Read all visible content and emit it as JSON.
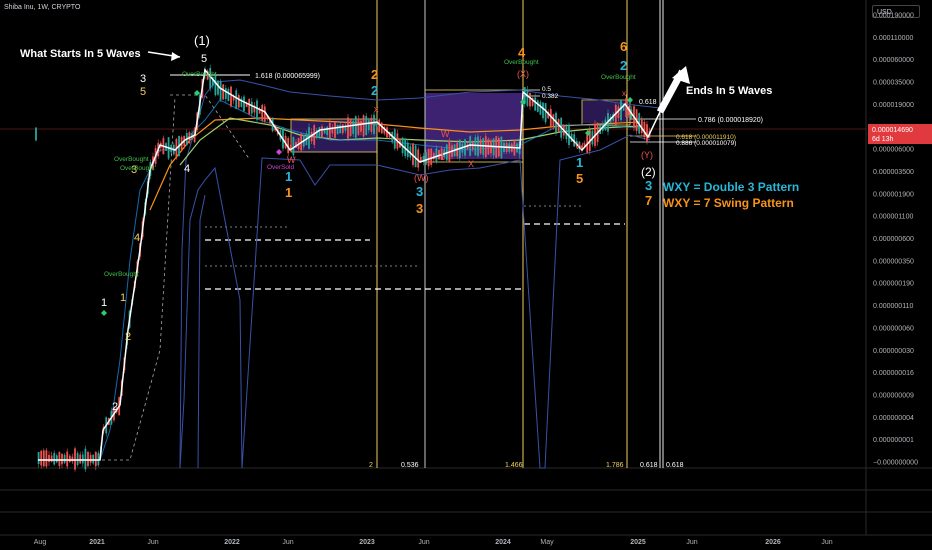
{
  "header": {
    "symbol_line": "Shiba Inu, 1W, CRYPTO",
    "currency_button": "USD"
  },
  "price_marker": {
    "value": "0.000014690",
    "countdown": "6d 13h"
  },
  "chart_data": {
    "type": "candlestick",
    "title": "Shiba Inu, 1W, CRYPTO",
    "y_scale": "log",
    "y_ticks": [
      "0.000190000",
      "0.000110000",
      "0.000060000",
      "0.000035000",
      "0.000019000",
      "0.000010000",
      "0.000006000",
      "0.000003500",
      "0.000001900",
      "0.000001100",
      "0.000000600",
      "0.000000350",
      "0.000000190",
      "0.000000110",
      "0.000000060",
      "0.000000030",
      "0.000000016",
      "0.000000009",
      "0.000000004",
      "0.000000001",
      "−0.000000000"
    ],
    "x_ticks": [
      "Aug",
      "2021",
      "Jun",
      "2022",
      "Jun",
      "2023",
      "Jun",
      "2024",
      "May",
      "2025",
      "Jun",
      "2026",
      "Jun"
    ],
    "last_price": 1.469e-05,
    "fib_levels": [
      {
        "label": "1.618 (0.000065999)",
        "value": 6.5999e-05
      },
      {
        "label": "0.5",
        "value": null
      },
      {
        "label": "0.382",
        "value": null
      },
      {
        "label": "0.618",
        "value": null
      },
      {
        "label": "0.786 (0.000018920)",
        "value": 1.892e-05
      },
      {
        "label": "0.618 (0.000011910)",
        "value": 1.191e-05
      },
      {
        "label": "0.886 (0.000010079)",
        "value": 1.0079e-05
      }
    ],
    "time_fib_labels": [
      "2",
      "0.536",
      "1.466",
      "1.786",
      "0.618",
      "0.618"
    ],
    "wave_labels": [
      "(1)",
      "5",
      "3",
      "5",
      "4",
      "3",
      "4",
      "2",
      "1",
      "1",
      "2",
      "1",
      "2",
      "2",
      "x",
      "1",
      "1",
      "W",
      "(W)",
      "3",
      "3",
      "W",
      "X",
      "4",
      "(X)",
      "1",
      "5",
      "W",
      "6",
      "2",
      "x",
      "(Y)",
      "(2)",
      "3",
      "7"
    ],
    "indicator_labels": [
      "OverBought",
      "OverBought",
      "OverSold",
      "OverBought",
      "OverBought",
      "OverBought",
      "OverBought"
    ],
    "text_annotations": [
      "What Starts In 5 Waves",
      "Ends In 5 Waves",
      "WXY = Double 3 Pattern",
      "WXY = 7 Swing Pattern"
    ]
  },
  "colors": {
    "up": "#26a69a",
    "down": "#ef5350",
    "fib": "#f0d060",
    "wave_orange": "#f7931a",
    "wave_teal": "#29b6d6",
    "box": "#4b2a8c"
  }
}
